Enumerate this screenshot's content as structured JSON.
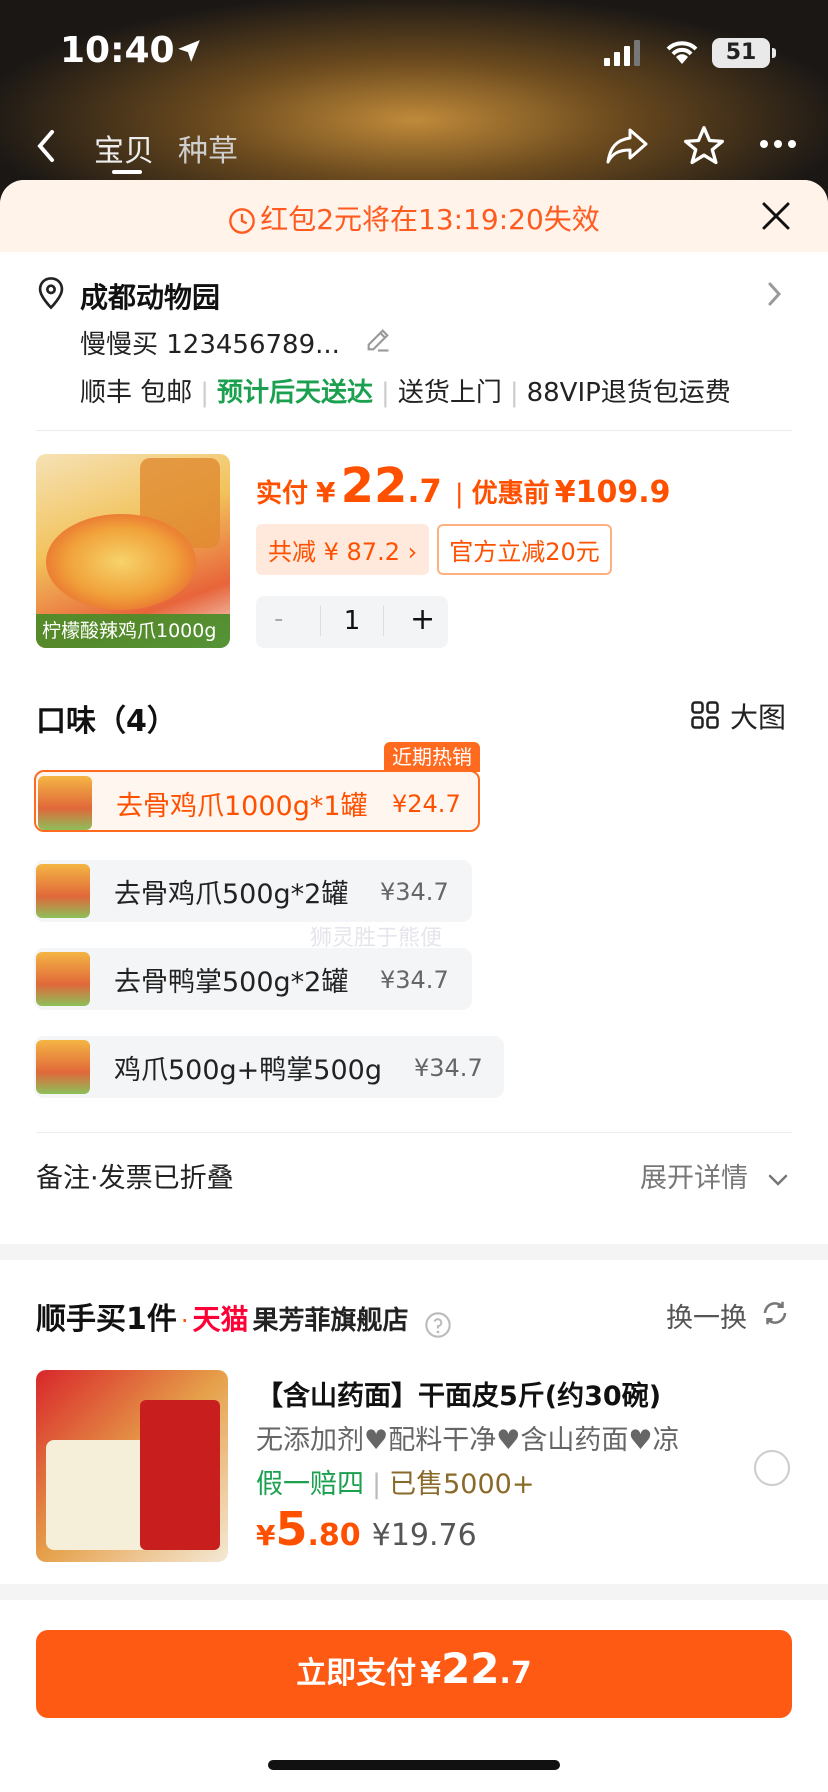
{
  "status": {
    "time": "10:40",
    "battery": "51"
  },
  "nav": {
    "tab_active": "宝贝",
    "tab_second": "种草"
  },
  "banner": {
    "text": "红包2元将在13:19:20失效"
  },
  "address": {
    "name": "成都动物园",
    "user": "慢慢买 123456789...",
    "shipping": "顺丰 包邮",
    "eta": "预计后天送达",
    "door": "送货上门",
    "vip": "88VIP退货包运费"
  },
  "product": {
    "caption": "柠檬酸辣鸡爪1000g",
    "paid_label": "实付",
    "yen": "¥",
    "price_int": "22",
    "price_dec": ".7",
    "before_label": "优惠前",
    "before_price": "¥109.9",
    "save_tag": "共减 ¥ 87.2 ›",
    "official_tag": "官方立减20元",
    "qty_minus": "-",
    "qty": "1",
    "qty_plus": "+"
  },
  "flavors": {
    "title": "口味（4）",
    "bigview": "大图",
    "hot": "近期热销",
    "options": [
      {
        "label": "去骨鸡爪1000g*1罐",
        "price": "¥24.7"
      },
      {
        "label": "去骨鸡爪500g*2罐",
        "price": "¥34.7"
      },
      {
        "label": "去骨鸭掌500g*2罐",
        "price": "¥34.7"
      },
      {
        "label": "鸡爪500g+鸭掌500g",
        "price": "¥34.7"
      }
    ]
  },
  "remark": {
    "label": "备注·发票已折叠",
    "expand": "展开详情"
  },
  "addon": {
    "title": "顺手买1件",
    "tmall": "天猫",
    "shop": "果芳菲旗舰店",
    "swap": "换一换",
    "name": "【含山药面】干面皮5斤(约30碗)",
    "desc": "无添加剂♥配料干净♥含山药面♥凉",
    "guarantee": "假一赔四",
    "sold": "已售5000+",
    "yen": "¥",
    "price_int": "5",
    "price_dec": ".80",
    "old_price": "¥19.76"
  },
  "pay": {
    "label": "立即支付",
    "yen": "¥",
    "price_int": "22",
    "price_dec": ".7"
  },
  "watermark": "狮灵胜于熊便"
}
